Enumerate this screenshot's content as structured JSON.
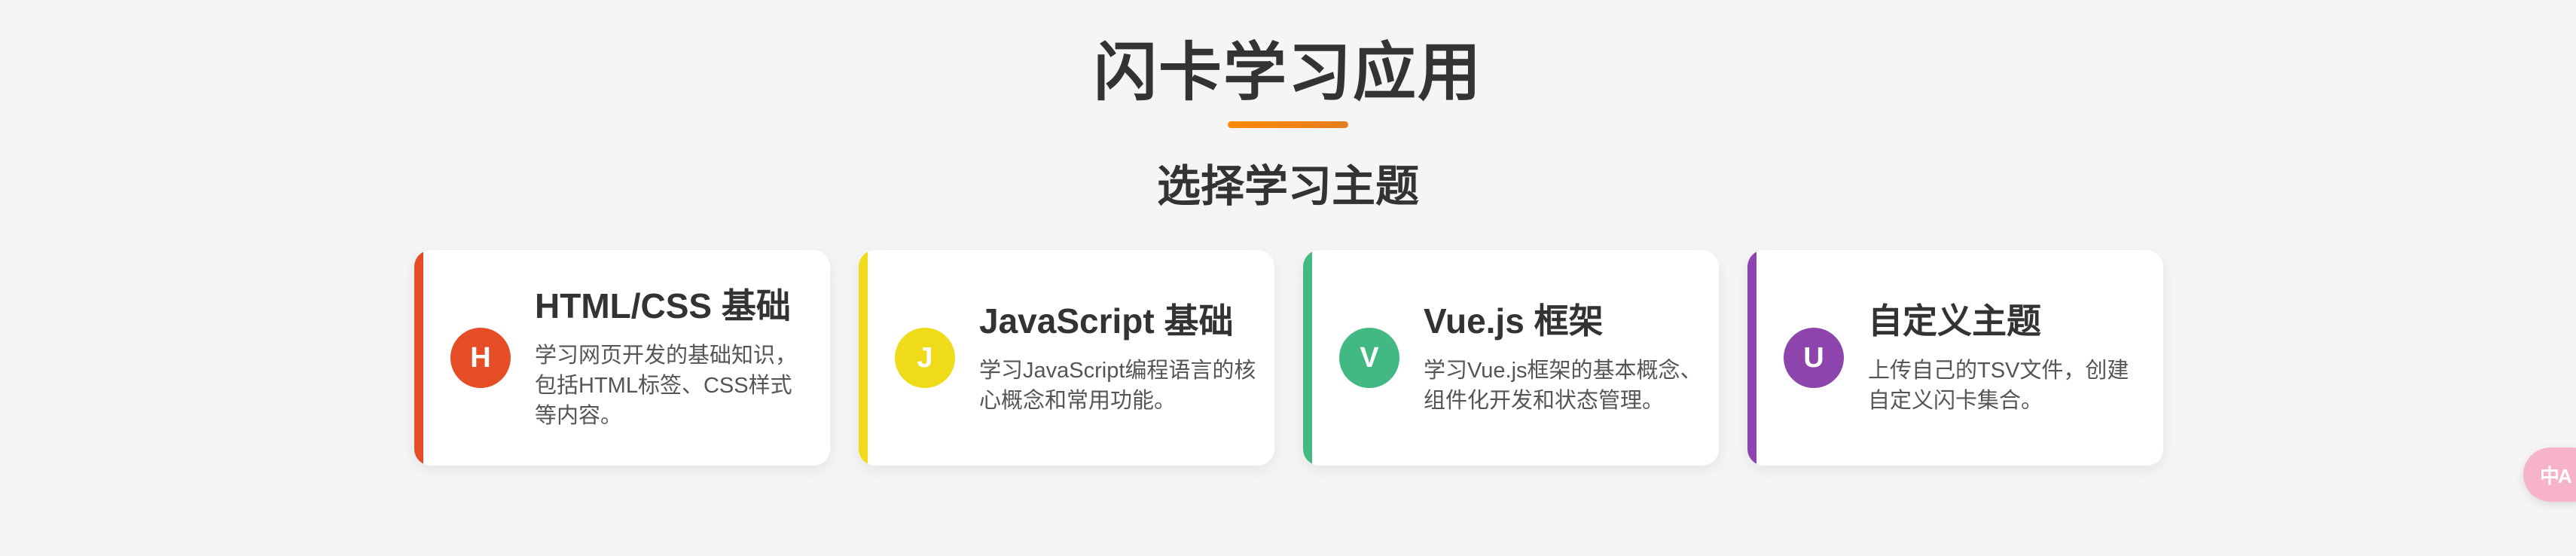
{
  "app": {
    "title": "闪卡学习应用",
    "section_title": "选择学习主题"
  },
  "topics": [
    {
      "icon_letter": "H",
      "icon_name": "html-topic-icon",
      "title": "HTML/CSS 基础",
      "description": "学习网页开发的基础知识，包括HTML标签、CSS样式等内容。",
      "color": "#e44d26"
    },
    {
      "icon_letter": "J",
      "icon_name": "javascript-topic-icon",
      "title": "JavaScript 基础",
      "description": "学习JavaScript编程语言的核心概念和常用功能。",
      "color": "#f0db1a"
    },
    {
      "icon_letter": "V",
      "icon_name": "vue-topic-icon",
      "title": "Vue.js 框架",
      "description": "学习Vue.js框架的基本概念、组件化开发和状态管理。",
      "color": "#42b883"
    },
    {
      "icon_letter": "U",
      "icon_name": "upload-topic-icon",
      "title": "自定义主题",
      "description": "上传自己的TSV文件，创建自定义闪卡集合。",
      "color": "#8e44ad"
    }
  ],
  "translate_fab": {
    "icon_name": "translate-icon",
    "glyph": "中A",
    "color": "#f7b3c7"
  }
}
